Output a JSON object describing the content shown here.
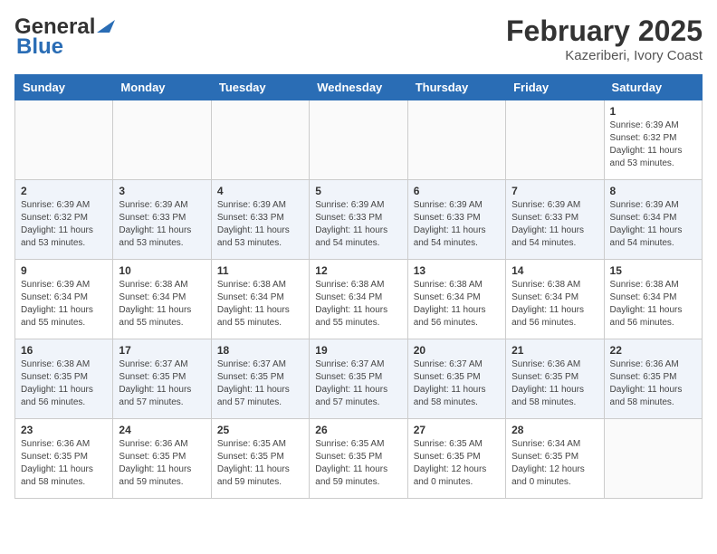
{
  "header": {
    "logo_line1": "General",
    "logo_line2": "Blue",
    "title": "February 2025",
    "subtitle": "Kazeriberi, Ivory Coast"
  },
  "days_of_week": [
    "Sunday",
    "Monday",
    "Tuesday",
    "Wednesday",
    "Thursday",
    "Friday",
    "Saturday"
  ],
  "weeks": [
    [
      {
        "day": "",
        "info": ""
      },
      {
        "day": "",
        "info": ""
      },
      {
        "day": "",
        "info": ""
      },
      {
        "day": "",
        "info": ""
      },
      {
        "day": "",
        "info": ""
      },
      {
        "day": "",
        "info": ""
      },
      {
        "day": "1",
        "info": "Sunrise: 6:39 AM\nSunset: 6:32 PM\nDaylight: 11 hours\nand 53 minutes."
      }
    ],
    [
      {
        "day": "2",
        "info": "Sunrise: 6:39 AM\nSunset: 6:32 PM\nDaylight: 11 hours\nand 53 minutes."
      },
      {
        "day": "3",
        "info": "Sunrise: 6:39 AM\nSunset: 6:33 PM\nDaylight: 11 hours\nand 53 minutes."
      },
      {
        "day": "4",
        "info": "Sunrise: 6:39 AM\nSunset: 6:33 PM\nDaylight: 11 hours\nand 53 minutes."
      },
      {
        "day": "5",
        "info": "Sunrise: 6:39 AM\nSunset: 6:33 PM\nDaylight: 11 hours\nand 54 minutes."
      },
      {
        "day": "6",
        "info": "Sunrise: 6:39 AM\nSunset: 6:33 PM\nDaylight: 11 hours\nand 54 minutes."
      },
      {
        "day": "7",
        "info": "Sunrise: 6:39 AM\nSunset: 6:33 PM\nDaylight: 11 hours\nand 54 minutes."
      },
      {
        "day": "8",
        "info": "Sunrise: 6:39 AM\nSunset: 6:34 PM\nDaylight: 11 hours\nand 54 minutes."
      }
    ],
    [
      {
        "day": "9",
        "info": "Sunrise: 6:39 AM\nSunset: 6:34 PM\nDaylight: 11 hours\nand 55 minutes."
      },
      {
        "day": "10",
        "info": "Sunrise: 6:38 AM\nSunset: 6:34 PM\nDaylight: 11 hours\nand 55 minutes."
      },
      {
        "day": "11",
        "info": "Sunrise: 6:38 AM\nSunset: 6:34 PM\nDaylight: 11 hours\nand 55 minutes."
      },
      {
        "day": "12",
        "info": "Sunrise: 6:38 AM\nSunset: 6:34 PM\nDaylight: 11 hours\nand 55 minutes."
      },
      {
        "day": "13",
        "info": "Sunrise: 6:38 AM\nSunset: 6:34 PM\nDaylight: 11 hours\nand 56 minutes."
      },
      {
        "day": "14",
        "info": "Sunrise: 6:38 AM\nSunset: 6:34 PM\nDaylight: 11 hours\nand 56 minutes."
      },
      {
        "day": "15",
        "info": "Sunrise: 6:38 AM\nSunset: 6:34 PM\nDaylight: 11 hours\nand 56 minutes."
      }
    ],
    [
      {
        "day": "16",
        "info": "Sunrise: 6:38 AM\nSunset: 6:35 PM\nDaylight: 11 hours\nand 56 minutes."
      },
      {
        "day": "17",
        "info": "Sunrise: 6:37 AM\nSunset: 6:35 PM\nDaylight: 11 hours\nand 57 minutes."
      },
      {
        "day": "18",
        "info": "Sunrise: 6:37 AM\nSunset: 6:35 PM\nDaylight: 11 hours\nand 57 minutes."
      },
      {
        "day": "19",
        "info": "Sunrise: 6:37 AM\nSunset: 6:35 PM\nDaylight: 11 hours\nand 57 minutes."
      },
      {
        "day": "20",
        "info": "Sunrise: 6:37 AM\nSunset: 6:35 PM\nDaylight: 11 hours\nand 58 minutes."
      },
      {
        "day": "21",
        "info": "Sunrise: 6:36 AM\nSunset: 6:35 PM\nDaylight: 11 hours\nand 58 minutes."
      },
      {
        "day": "22",
        "info": "Sunrise: 6:36 AM\nSunset: 6:35 PM\nDaylight: 11 hours\nand 58 minutes."
      }
    ],
    [
      {
        "day": "23",
        "info": "Sunrise: 6:36 AM\nSunset: 6:35 PM\nDaylight: 11 hours\nand 58 minutes."
      },
      {
        "day": "24",
        "info": "Sunrise: 6:36 AM\nSunset: 6:35 PM\nDaylight: 11 hours\nand 59 minutes."
      },
      {
        "day": "25",
        "info": "Sunrise: 6:35 AM\nSunset: 6:35 PM\nDaylight: 11 hours\nand 59 minutes."
      },
      {
        "day": "26",
        "info": "Sunrise: 6:35 AM\nSunset: 6:35 PM\nDaylight: 11 hours\nand 59 minutes."
      },
      {
        "day": "27",
        "info": "Sunrise: 6:35 AM\nSunset: 6:35 PM\nDaylight: 12 hours\nand 0 minutes."
      },
      {
        "day": "28",
        "info": "Sunrise: 6:34 AM\nSunset: 6:35 PM\nDaylight: 12 hours\nand 0 minutes."
      },
      {
        "day": "",
        "info": ""
      }
    ]
  ]
}
